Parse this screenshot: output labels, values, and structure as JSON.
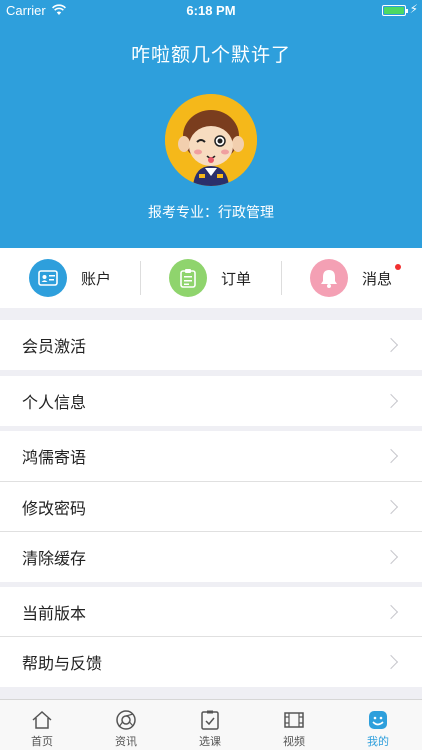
{
  "status_bar": {
    "carrier": "Carrier",
    "time": "6:18 PM"
  },
  "header": {
    "title": "咋啦额几个默许了",
    "major": "报考专业：行政管理"
  },
  "quick_actions": [
    {
      "label": "账户",
      "icon": "id-card-icon",
      "color": "#2e9fdc"
    },
    {
      "label": "订单",
      "icon": "clipboard-icon",
      "color": "#8fd46d"
    },
    {
      "label": "消息",
      "icon": "bell-icon",
      "color": "#f4a0b4"
    }
  ],
  "menu": {
    "member_activate": "会员激活",
    "personal_info": "个人信息",
    "hongru_message": "鸿儒寄语",
    "change_password": "修改密码",
    "clear_cache": "清除缓存",
    "current_version": "当前版本",
    "help_feedback": "帮助与反馈"
  },
  "tabs": [
    {
      "label": "首页",
      "icon": "home-icon"
    },
    {
      "label": "资讯",
      "icon": "news-icon"
    },
    {
      "label": "选课",
      "icon": "course-select-icon"
    },
    {
      "label": "视频",
      "icon": "video-icon"
    },
    {
      "label": "我的",
      "icon": "profile-icon",
      "active": true
    }
  ],
  "colors": {
    "primary": "#2e9fdc",
    "background": "#efeff4",
    "badge": "#f23030"
  }
}
